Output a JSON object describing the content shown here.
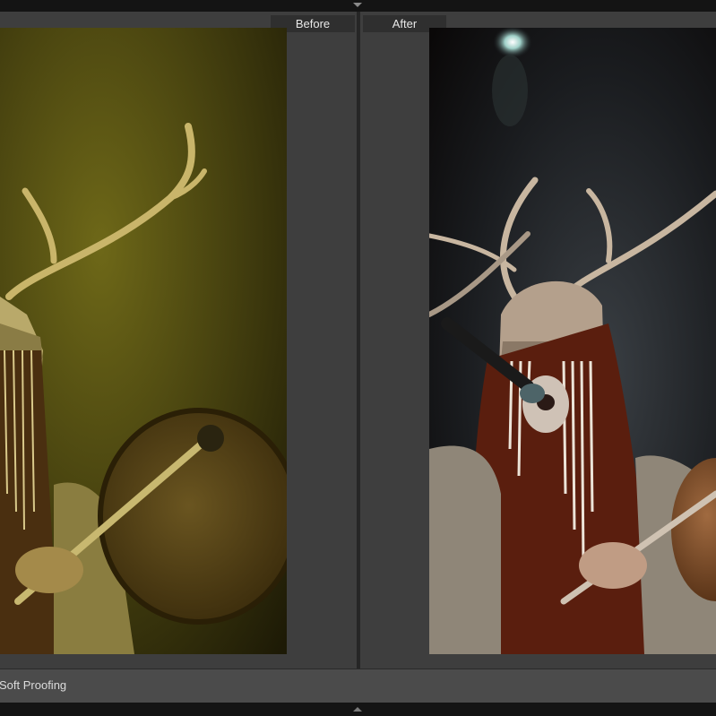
{
  "compare": {
    "before_label": "Before",
    "after_label": "After"
  },
  "toolbar": {
    "soft_proofing_label": "Soft Proofing"
  },
  "icons": {
    "top_panel_toggle": "triangle-down-icon",
    "bottom_panel_toggle": "triangle-up-icon"
  },
  "colors": {
    "before_tint": "#6b6414",
    "after_background": "#111111",
    "panel_background": "#3e3e3e",
    "toolbar_background": "#4b4b4b"
  }
}
